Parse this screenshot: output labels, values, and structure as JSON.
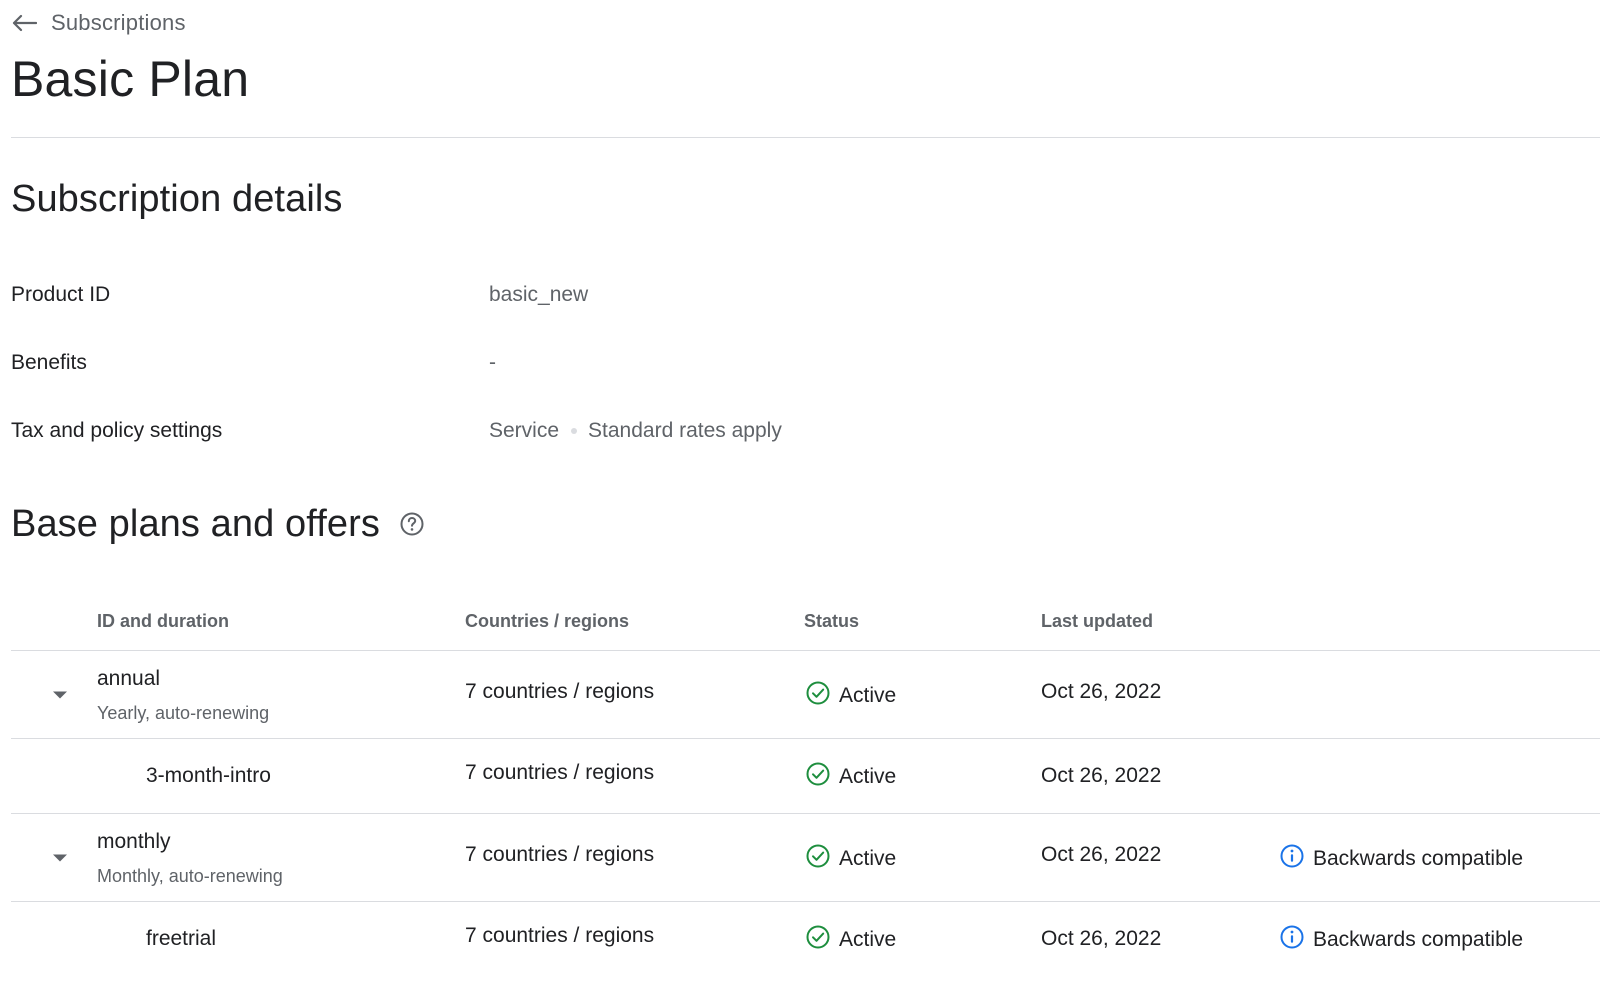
{
  "breadcrumb": {
    "label": "Subscriptions",
    "icon": "arrow-back-icon"
  },
  "page": {
    "title": "Basic Plan"
  },
  "subscription_details": {
    "title": "Subscription details",
    "rows": [
      {
        "label": "Product ID",
        "value": "basic_new"
      },
      {
        "label": "Benefits",
        "value": "-"
      },
      {
        "label": "Tax and policy settings",
        "value_parts": [
          "Service",
          "Standard rates apply"
        ]
      }
    ]
  },
  "base_plans": {
    "title": "Base plans and offers",
    "help_icon": "help-circle-icon",
    "columns": [
      "ID and duration",
      "Countries / regions",
      "Status",
      "Last updated"
    ],
    "rows": [
      {
        "type": "base_plan",
        "id": "annual",
        "duration": "Yearly, auto-renewing",
        "countries": "7 countries / regions",
        "status": "Active",
        "last_updated": "Oct 26, 2022",
        "note": ""
      },
      {
        "type": "offer",
        "id": "3-month-intro",
        "countries": "7 countries / regions",
        "status": "Active",
        "last_updated": "Oct 26, 2022",
        "note": ""
      },
      {
        "type": "base_plan",
        "id": "monthly",
        "duration": "Monthly, auto-renewing",
        "countries": "7 countries / regions",
        "status": "Active",
        "last_updated": "Oct 26, 2022",
        "note": "Backwards compatible"
      },
      {
        "type": "offer",
        "id": "freetrial",
        "countries": "7 countries / regions",
        "status": "Active",
        "last_updated": "Oct 26, 2022",
        "note": "Backwards compatible"
      }
    ]
  },
  "colors": {
    "active_green": "#1e8e3e",
    "info_blue": "#1a73e8",
    "divider": "#dadce0",
    "secondary_text": "#5f6368"
  }
}
